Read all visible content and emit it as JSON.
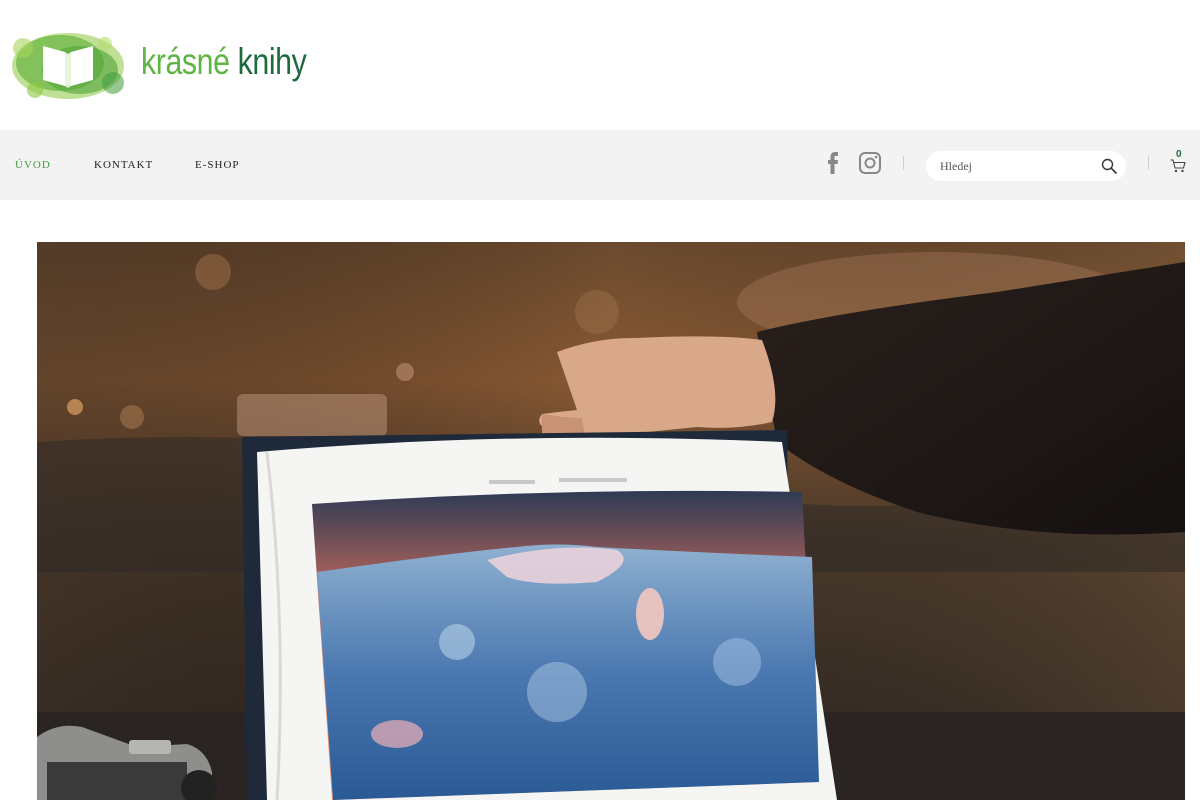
{
  "brand": {
    "name_part1": "krásné",
    "name_part2": "knihy",
    "colors": {
      "light_green": "#5fb543",
      "dark_green": "#1d6b3c"
    }
  },
  "nav": {
    "items": [
      {
        "label": "ÚVOD",
        "active": true
      },
      {
        "label": "KONTAKT",
        "active": false
      },
      {
        "label": "E-SHOP",
        "active": false
      }
    ],
    "active_color": "#3f9a3a"
  },
  "social": {
    "icons": [
      "facebook-icon",
      "instagram-icon"
    ]
  },
  "search": {
    "placeholder": "Hledej",
    "value": ""
  },
  "cart": {
    "count": "0"
  },
  "hero": {
    "description_icon": "photo-book-hero-image"
  }
}
